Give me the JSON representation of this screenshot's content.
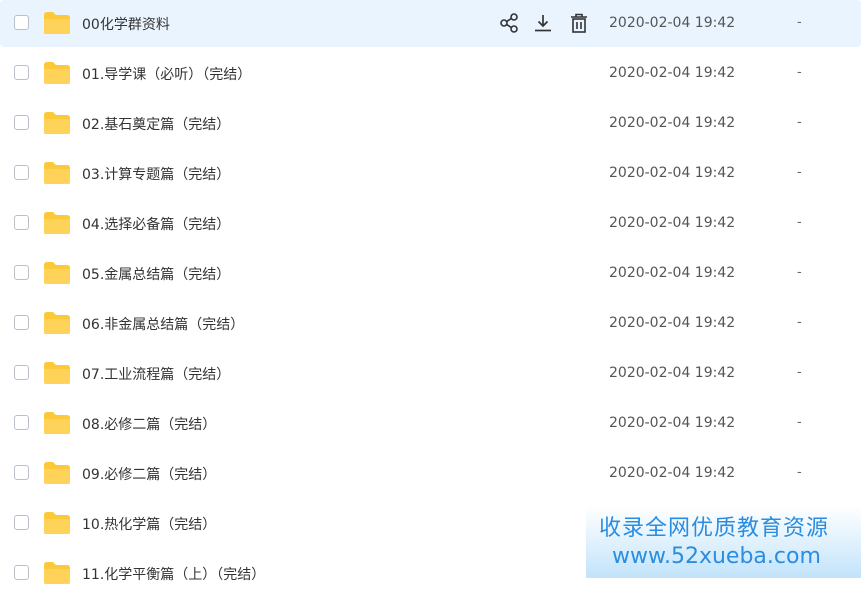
{
  "files": [
    {
      "name": "00化学群资料",
      "date": "2020-02-04 19:42",
      "size": "-",
      "hover": true
    },
    {
      "name": "01.导学课（必听）（完结）",
      "date": "2020-02-04 19:42",
      "size": "-"
    },
    {
      "name": "02.基石奠定篇（完结）",
      "date": "2020-02-04 19:42",
      "size": "-"
    },
    {
      "name": "03.计算专题篇（完结）",
      "date": "2020-02-04 19:42",
      "size": "-"
    },
    {
      "name": "04.选择必备篇（完结）",
      "date": "2020-02-04 19:42",
      "size": "-"
    },
    {
      "name": "05.金属总结篇（完结）",
      "date": "2020-02-04 19:42",
      "size": "-"
    },
    {
      "name": "06.非金属总结篇（完结）",
      "date": "2020-02-04 19:42",
      "size": "-"
    },
    {
      "name": "07.工业流程篇（完结）",
      "date": "2020-02-04 19:42",
      "size": "-"
    },
    {
      "name": "08.必修二篇（完结）",
      "date": "2020-02-04 19:42",
      "size": "-"
    },
    {
      "name": "09.必修二篇（完结）",
      "date": "2020-02-04 19:42",
      "size": "-"
    },
    {
      "name": "10.热化学篇（完结）",
      "date": "",
      "size": ""
    },
    {
      "name": "11.化学平衡篇（上）（完结）",
      "date": "",
      "size": ""
    }
  ],
  "row_actions": [
    "share-icon",
    "download-icon",
    "delete-icon"
  ],
  "watermark": {
    "line1": "收录全网优质教育资源",
    "line2": "www.52xueba.com"
  },
  "colors": {
    "hover_bg": "#eaf4ff",
    "folder": "#fcc93b",
    "watermark_text": "#2b8de0"
  }
}
